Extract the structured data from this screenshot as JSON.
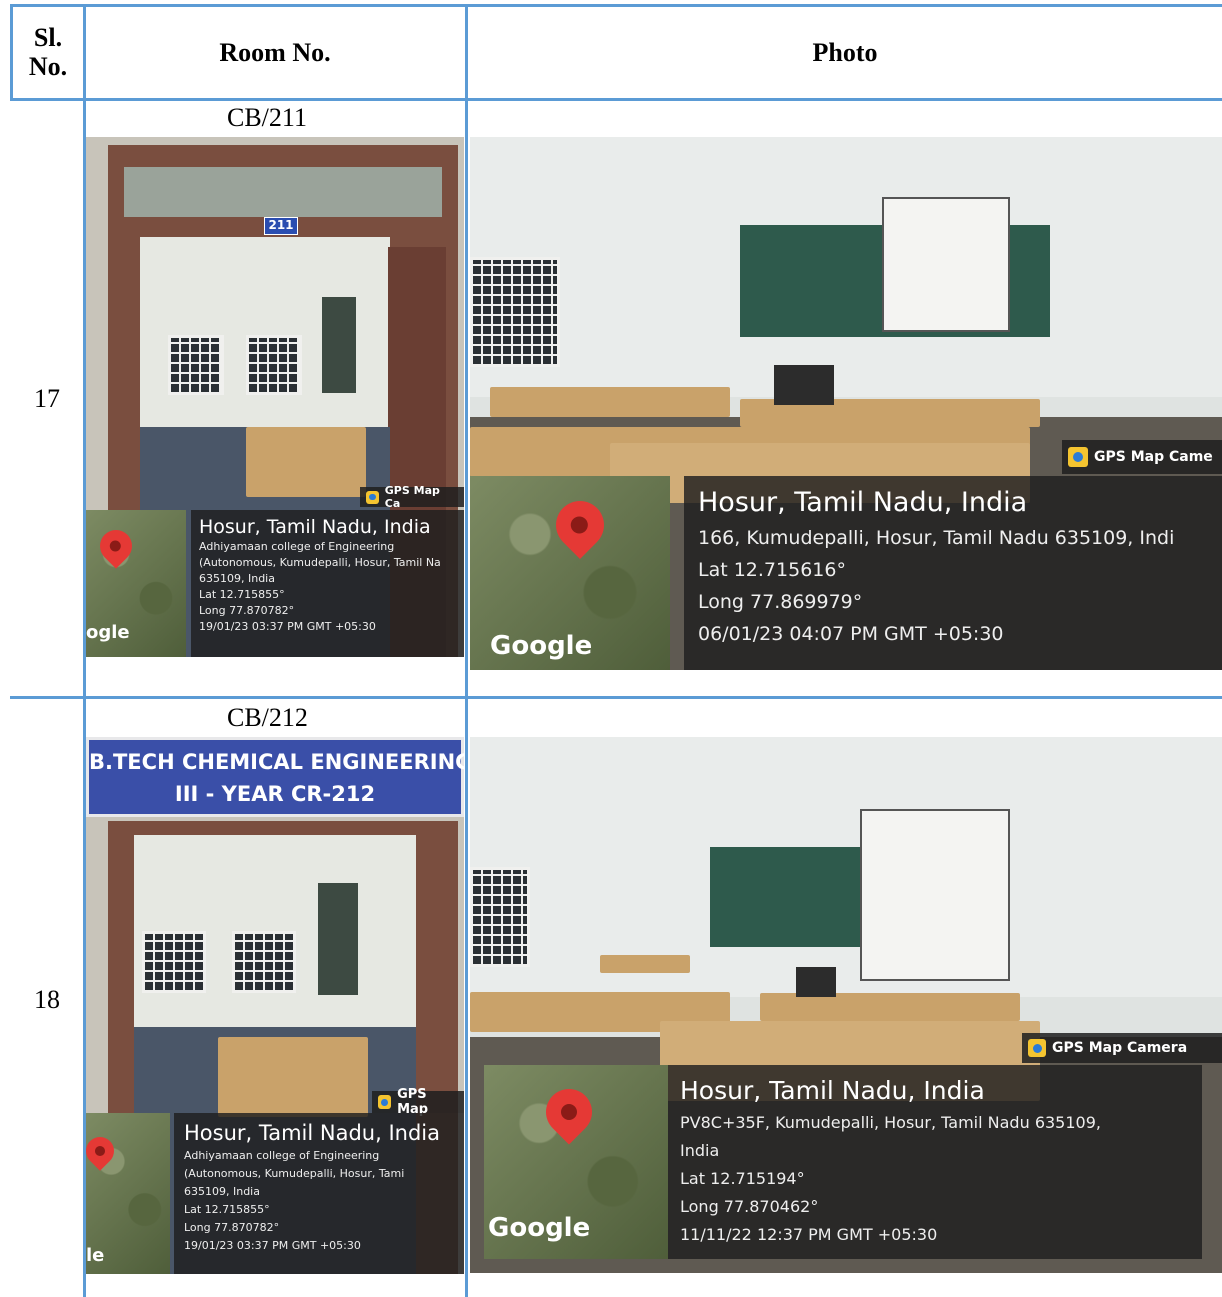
{
  "table": {
    "headers": {
      "sl_no": "Sl.\nNo.",
      "room_no": "Room No.",
      "photo": "Photo"
    },
    "rows": [
      {
        "sl_no": "17",
        "room_no": "CB/211",
        "door_tag": "211",
        "door_gps": {
          "badge": "GPS Map Ca",
          "title": "Hosur, Tamil Nadu, India",
          "line1": "Adhiyamaan college of Engineering",
          "line2": "(Autonomous, Kumudepalli, Hosur, Tamil Na",
          "line3": "635109, India",
          "lat": "Lat 12.715855°",
          "long": "Long 77.870782°",
          "timestamp": "19/01/23 03:37 PM GMT +05:30",
          "google": "ogle"
        },
        "class_gps": {
          "badge": "GPS Map Came",
          "title": "Hosur, Tamil Nadu, India",
          "line1": "166, Kumudepalli, Hosur, Tamil Nadu 635109, Indi",
          "lat": "Lat 12.715616°",
          "long": "Long 77.869979°",
          "timestamp": "06/01/23 04:07 PM GMT +05:30",
          "google": "Google"
        }
      },
      {
        "sl_no": "18",
        "room_no": "CB/212",
        "sign_line1": "B.TECH CHEMICAL ENGINEERING",
        "sign_line2": "III - YEAR CR-212",
        "door_gps": {
          "badge": "GPS Map",
          "title": "Hosur, Tamil Nadu, India",
          "line1": "Adhiyamaan college of Engineering",
          "line2": "(Autonomous, Kumudepalli, Hosur, Tami",
          "line3": "635109, India",
          "lat": "Lat 12.715855°",
          "long": "Long 77.870782°",
          "timestamp": "19/01/23 03:37 PM GMT +05:30",
          "google": "le"
        },
        "class_gps": {
          "badge": "GPS Map Camera",
          "title": "Hosur, Tamil Nadu, India",
          "line1": "PV8C+35F, Kumudepalli, Hosur, Tamil Nadu 635109,",
          "line2": "India",
          "lat": "Lat 12.715194°",
          "long": "Long 77.870462°",
          "timestamp": "11/11/22 12:37 PM GMT +05:30",
          "google": "Google"
        }
      }
    ]
  }
}
